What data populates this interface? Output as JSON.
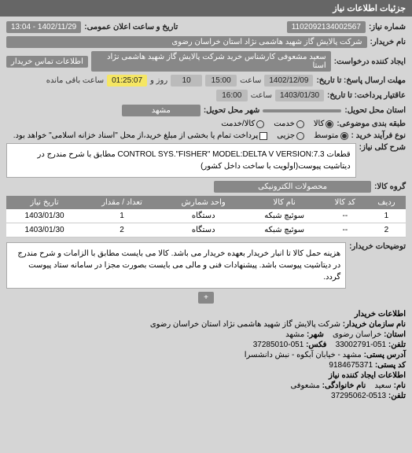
{
  "header": {
    "title": "جزئیات اطلاعات نیاز"
  },
  "fields": {
    "request_no_label": "شماره نیاز:",
    "request_no": "1102092134002567",
    "announce_label": "تاریخ و ساعت اعلان عمومی:",
    "announce_value": "1402/11/29 - 13:04",
    "buyer_name_label": "نام خریدار:",
    "buyer_name": "شرکت پالایش گاز شهید هاشمی نژاد   استان خراسان رضوی",
    "creator_label": "ایجاد کننده درخواست:",
    "creator": "سعید مشعوفی کارشناس خرید شرکت پالایش گاز شهید هاشمی نژاد   استا",
    "contact_btn": "اطلاعات تماس خریدار",
    "deadline_label": "مهلت ارسال پاسخ: تا تاریخ:",
    "deadline_date": "1402/12/09",
    "deadline_hour_label": "ساعت",
    "deadline_hour": "15:00",
    "remaining_days": "10",
    "remaining_time": "01:25:07",
    "remaining_days_label": "روز و",
    "remaining_left_label": "ساعت باقی مانده",
    "valid_label": "عاقتیار پرداخت: تا تاریخ:",
    "valid_date": "1403/01/30",
    "valid_hour_label": "ساعت",
    "valid_hour": "16:00",
    "province_label": "استان محل تحویل:",
    "city_label": "شهر محل تحویل:",
    "city": "مشهد",
    "packing_label": "طبقه بندی موضوعی:",
    "opt_goods": "کالا",
    "opt_service": "خدمت",
    "opt_mixed": "کالا/خدمت",
    "buy_type_label": "نوع فرآیند خرید :",
    "opt_medium": "متوسط",
    "opt_minor": "جزیی",
    "pay_note": "پرداخت تمام یا بخشی از مبلغ خرید،از محل \"اسناد خزانه اسلامی\" خواهد بود.",
    "general_label": "شرح کلی نیاز:",
    "general_value": "قطعات CONTROL SYS.\"FISHER\" MODEL:DELTA V VERSION:7.3 مطابق با شرح مندرج در دیتاشیت پیوست(اولویت با ساخت داخل کشور)",
    "group_label": "گروه کالا:",
    "group_value": "محصولات الکترونیکی",
    "desc_label": "توضیحات خریدار:",
    "desc_value": "هزینه حمل کالا تا انبار خریدار بعهده خریدار می باشد. کالا می بایست مطابق با الزامات و شرح مندرج در دیتاشیت پیوست باشد. پیشنهادات فنی و مالی می بایست بصورت مجزا در سامانه ستاد پیوست گردد.",
    "expand": "+"
  },
  "table": {
    "headers": [
      "ردیف",
      "کد کالا",
      "نام کالا",
      "واحد شمارش",
      "تعداد / مقدار",
      "تاریخ نیاز"
    ],
    "rows": [
      [
        "1",
        "--",
        "سوئیچ شبکه",
        "دستگاه",
        "1",
        "1403/01/30"
      ],
      [
        "2",
        "--",
        "سوئیچ شبکه",
        "دستگاه",
        "2",
        "1403/01/30"
      ]
    ]
  },
  "footer": {
    "section_title": "اطلاعات خریدار",
    "org_label": "نام سازمان خریدار:",
    "org_value": "شرکت پالایش گاز شهید هاشمی نژاد استان خراسان رضوی",
    "province_label": "استان:",
    "province_value": "خراسان رضوی",
    "city_label": "شهر:",
    "city_value": "مشهد",
    "phone_label": "تلفن:",
    "phone_value": "051-33002791",
    "fax_label": "فکس:",
    "fax_value": "051-37285010",
    "address_label": "آدرس پستی:",
    "address_value": "مشهد - خیابان آبکوه - نبش دانشسرا",
    "postcode_label": "کد پستی:",
    "postcode_value": "9184675371",
    "creator_section": "اطلاعات ایجاد کننده نیاز",
    "name_label": "نام:",
    "name_value": "سعید",
    "family_label": "نام خانوادگی:",
    "family_value": "مشعوفی",
    "tel_label": "تلفن:",
    "tel_value": "0513-37295062"
  }
}
